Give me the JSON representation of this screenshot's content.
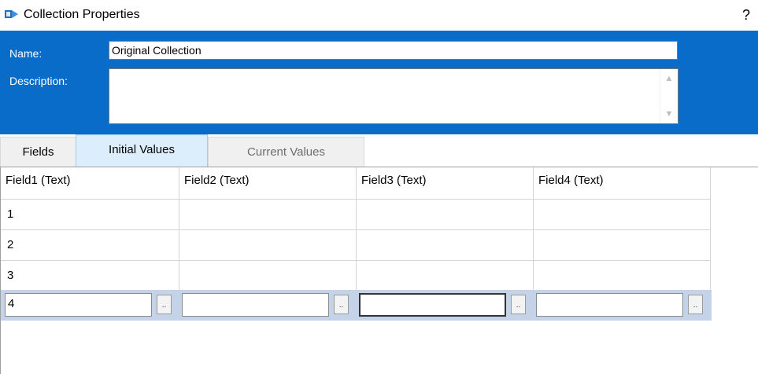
{
  "window": {
    "title": "Collection Properties",
    "help": "?"
  },
  "header": {
    "name_label": "Name:",
    "name_value": "Original Collection",
    "description_label": "Description:",
    "description_value": ""
  },
  "tabs": [
    {
      "label": "Fields",
      "state": "normal"
    },
    {
      "label": "Initial Values",
      "state": "selected"
    },
    {
      "label": "Current Values",
      "state": "disabled"
    }
  ],
  "grid": {
    "columns": [
      "Field1  (Text)",
      "Field2  (Text)",
      "Field3  (Text)",
      "Field4  (Text)"
    ],
    "rows": [
      [
        "1",
        "",
        "",
        ""
      ],
      [
        "2",
        "",
        "",
        ""
      ],
      [
        "3",
        "",
        "",
        ""
      ]
    ],
    "edit_row": [
      "4",
      "",
      "",
      ""
    ],
    "ellipsis_label": ".."
  },
  "colors": {
    "header_bg": "#0a6cc9",
    "selected_tab": "#dceefb",
    "edit_row": "#c5d3e8"
  }
}
